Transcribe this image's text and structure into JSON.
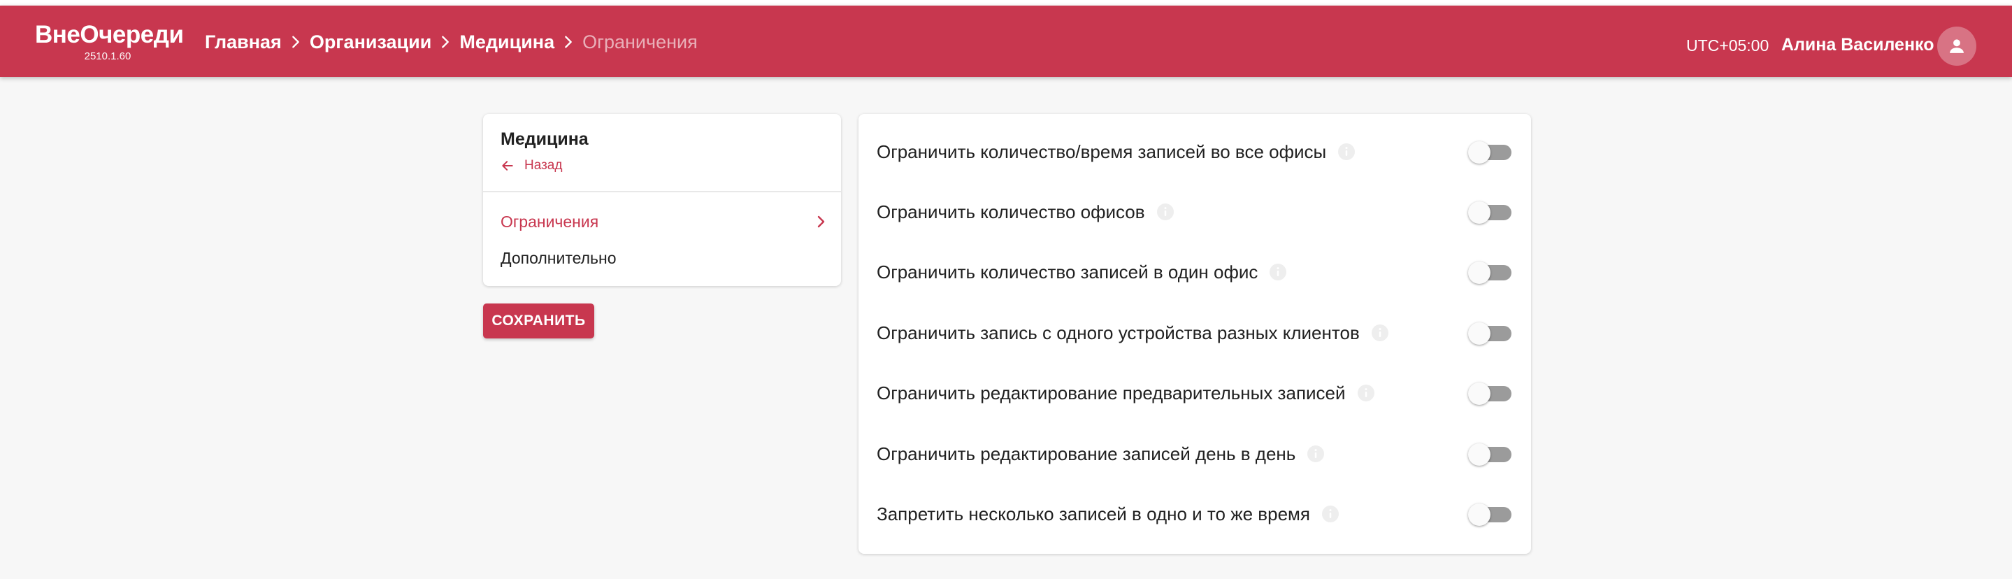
{
  "appbar": {
    "brand": "ВнеОчереди",
    "version": "2510.1.60",
    "timezone": "UTC+05:00",
    "user_name": "Алина Василенко",
    "background_color": "#c8374f"
  },
  "breadcrumbs": [
    {
      "label": "Главная"
    },
    {
      "label": "Организации"
    },
    {
      "label": "Медицина"
    },
    {
      "label": "Ограничения"
    }
  ],
  "sidebar": {
    "title": "Медицина",
    "back_label": "Назад",
    "items": [
      {
        "label": "Ограничения",
        "active": true
      },
      {
        "label": "Дополнительно",
        "active": false
      }
    ]
  },
  "save_label": "СОХРАНИТЬ",
  "settings": [
    {
      "label": "Ограничить количество/время записей во все офисы",
      "enabled": false
    },
    {
      "label": "Ограничить количество офисов",
      "enabled": false
    },
    {
      "label": "Ограничить количество записей в один офис",
      "enabled": false
    },
    {
      "label": "Ограничить запись с одного устройства разных клиентов",
      "enabled": false
    },
    {
      "label": "Ограничить редактирование предварительных записей",
      "enabled": false
    },
    {
      "label": "Ограничить редактирование записей день в день",
      "enabled": false
    },
    {
      "label": "Запретить несколько записей в одно и то же время",
      "enabled": false
    }
  ]
}
